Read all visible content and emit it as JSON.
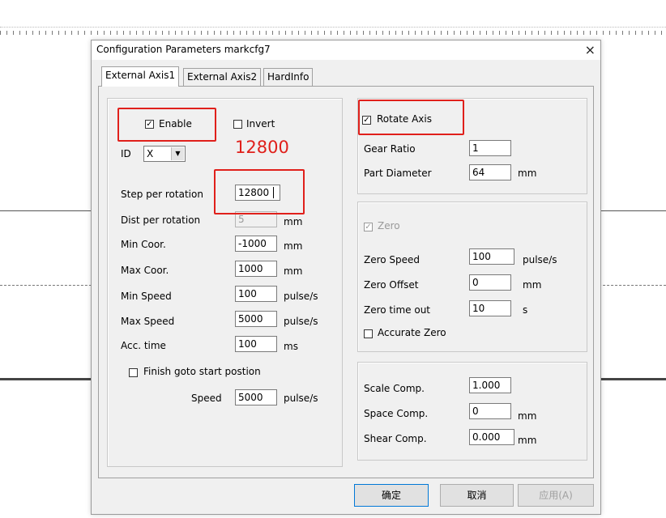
{
  "dialog": {
    "title": "Configuration Parameters markcfg7",
    "close_glyph": "×"
  },
  "tabs": [
    {
      "label": "External Axis1",
      "active": true
    },
    {
      "label": "External Axis2",
      "active": false
    },
    {
      "label": "HardInfo",
      "active": false
    }
  ],
  "left_panel": {
    "enable_label": "Enable",
    "enable_checked": true,
    "invert_label": "Invert",
    "invert_checked": false,
    "id_label": "ID",
    "id_value": "X",
    "annotation": "12800",
    "fields": [
      {
        "label": "Step per rotation",
        "value": "12800",
        "unit": ""
      },
      {
        "label": "Dist per rotation",
        "value": "5",
        "unit": "mm"
      },
      {
        "label": "Min Coor.",
        "value": "-1000",
        "unit": "mm"
      },
      {
        "label": "Max Coor.",
        "value": "1000",
        "unit": "mm"
      },
      {
        "label": "Min Speed",
        "value": "100",
        "unit": "pulse/s"
      },
      {
        "label": "Max Speed",
        "value": "5000",
        "unit": "pulse/s"
      },
      {
        "label": "Acc. time",
        "value": "100",
        "unit": "ms"
      }
    ],
    "finish_goto_label": "Finish goto start postion",
    "finish_goto_checked": false,
    "speed_label": "Speed",
    "speed_value": "5000",
    "speed_unit": "pulse/s"
  },
  "rotate_group": {
    "rotate_label": "Rotate Axis",
    "rotate_checked": true,
    "gear_ratio_label": "Gear Ratio",
    "gear_ratio_value": "1",
    "part_diameter_label": "Part Diameter",
    "part_diameter_value": "64",
    "part_diameter_unit": "mm"
  },
  "zero_group": {
    "zero_label": "Zero",
    "zero_checked": true,
    "zero_speed_label": "Zero Speed",
    "zero_speed_value": "100",
    "zero_speed_unit": "pulse/s",
    "zero_offset_label": "Zero Offset",
    "zero_offset_value": "0",
    "zero_offset_unit": "mm",
    "zero_timeout_label": "Zero time out",
    "zero_timeout_value": "10",
    "zero_timeout_unit": "s",
    "accurate_zero_label": "Accurate Zero",
    "accurate_zero_checked": false
  },
  "comp_group": {
    "scale_label": "Scale Comp.",
    "scale_value": "1.000",
    "space_label": "Space Comp.",
    "space_value": "0",
    "space_unit": "mm",
    "shear_label": "Shear Comp.",
    "shear_value": "0.000",
    "shear_unit": "mm"
  },
  "buttons": {
    "ok": "确定",
    "cancel": "取消",
    "apply": "应用(A)"
  },
  "check_glyph": "✓"
}
